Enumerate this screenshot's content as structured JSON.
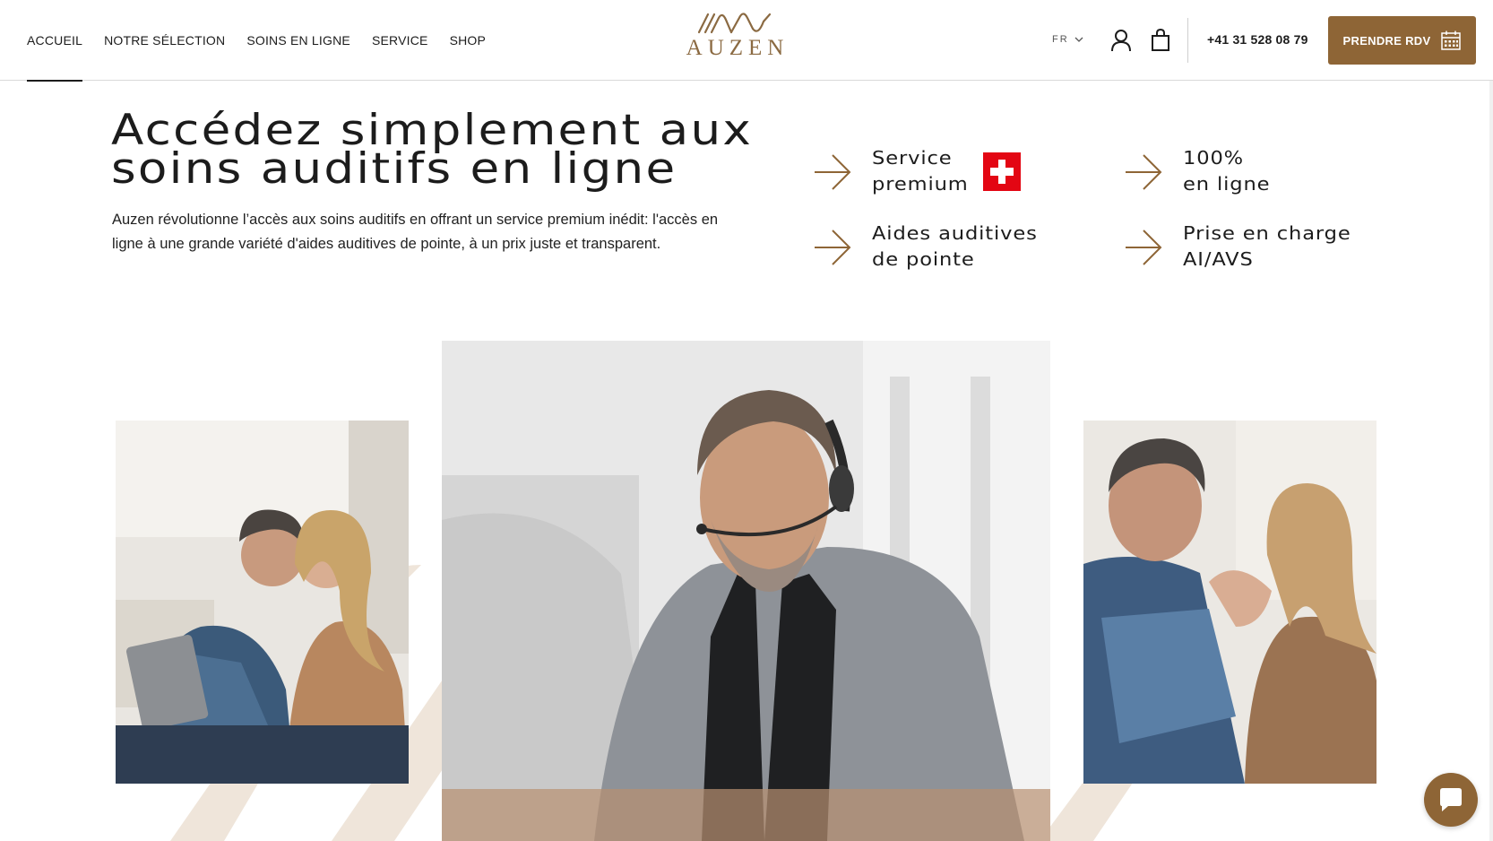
{
  "header": {
    "nav": [
      {
        "label": "ACCUEIL",
        "active": true
      },
      {
        "label": "NOTRE SÉLECTION",
        "active": false
      },
      {
        "label": "SOINS EN LIGNE",
        "active": false
      },
      {
        "label": "SERVICE",
        "active": false
      },
      {
        "label": "SHOP",
        "active": false
      }
    ],
    "logo_text": "AUZEN",
    "language": "FR",
    "phone": "+41 31 528 08 79",
    "cta_label": "PRENDRE RDV"
  },
  "hero": {
    "title_line1": "Accédez simplement aux",
    "title_line2": "soins auditifs en ligne",
    "description": "Auzen révolutionne l’accès aux soins auditifs en offrant un service premium inédit: l'accès en ligne à une grande variété d'aides auditives de pointe, à un prix juste et transparent."
  },
  "features": [
    {
      "line1": "Service",
      "line2": "premium",
      "icon": "swiss-flag-icon"
    },
    {
      "line1": "100%",
      "line2": "en ligne"
    },
    {
      "line1": "Aides auditives",
      "line2": "de pointe"
    },
    {
      "line1": "Prise en charge",
      "line2": "AI/AVS"
    }
  ],
  "icons": {
    "account": "user-icon",
    "cart": "shopping-bag-icon",
    "calendar": "calendar-icon",
    "chat": "chat-icon",
    "feature_arrow": "arrow-right-icon"
  },
  "colors": {
    "brand": "#8e6536",
    "logo": "#8b6a42",
    "swiss_red": "#e30613",
    "text": "#1c1c1c",
    "stripe": "#efe5da"
  },
  "photos": [
    {
      "name": "couple-with-tablet-photo"
    },
    {
      "name": "audiologist-with-headset-photo"
    },
    {
      "name": "smiling-couple-photo"
    }
  ]
}
